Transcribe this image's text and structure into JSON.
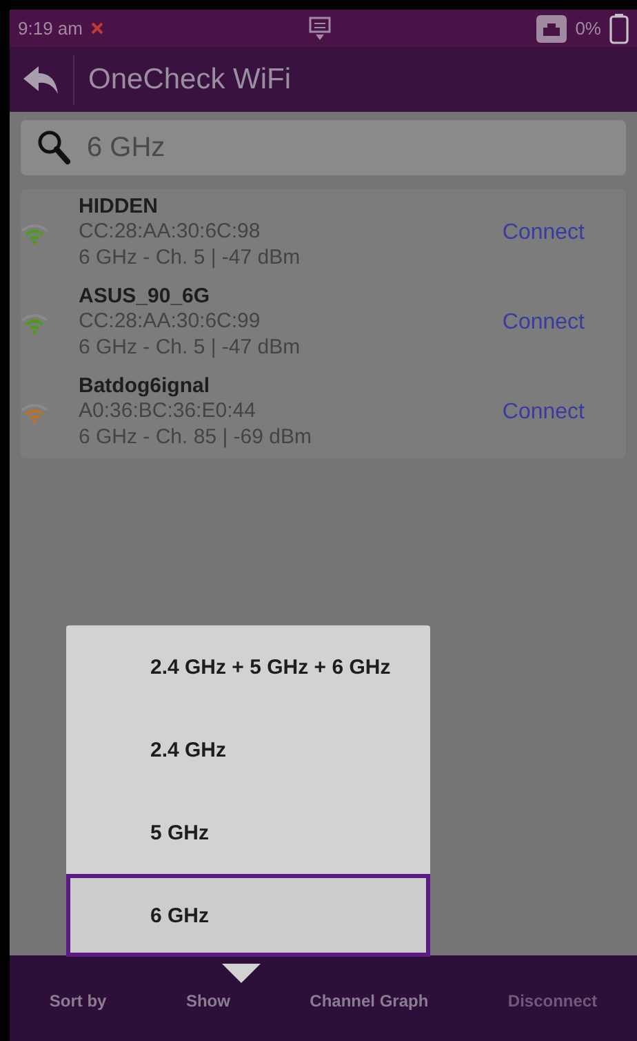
{
  "status_bar": {
    "time": "9:19 am",
    "battery": "0%"
  },
  "title_bar": {
    "title": "OneCheck WiFi"
  },
  "search": {
    "value": "6 GHz"
  },
  "networks": [
    {
      "name": "HIDDEN",
      "mac": "CC:28:AA:30:6C:98",
      "details": "6 GHz - Ch. 5 | -47 dBm",
      "color": "#4f9a1e",
      "action": "Connect"
    },
    {
      "name": "ASUS_90_6G",
      "mac": "CC:28:AA:30:6C:99",
      "details": "6 GHz - Ch. 5 | -47 dBm",
      "color": "#4f9a1e",
      "action": "Connect"
    },
    {
      "name": "Batdog6ignal",
      "mac": "A0:36:BC:36:E0:44",
      "details": "6 GHz - Ch. 85 | -69 dBm",
      "color": "#b8732a",
      "action": "Connect"
    }
  ],
  "show_menu": [
    {
      "label": "2.4 GHz + 5 GHz + 6 GHz",
      "selected": false
    },
    {
      "label": "2.4 GHz",
      "selected": false
    },
    {
      "label": "5 GHz",
      "selected": false
    },
    {
      "label": "6 GHz",
      "selected": true
    }
  ],
  "bottom_bar": [
    {
      "label": "Sort by",
      "disabled": false
    },
    {
      "label": "Show",
      "disabled": false
    },
    {
      "label": "Channel Graph",
      "disabled": false
    },
    {
      "label": "Disconnect",
      "disabled": true
    }
  ]
}
